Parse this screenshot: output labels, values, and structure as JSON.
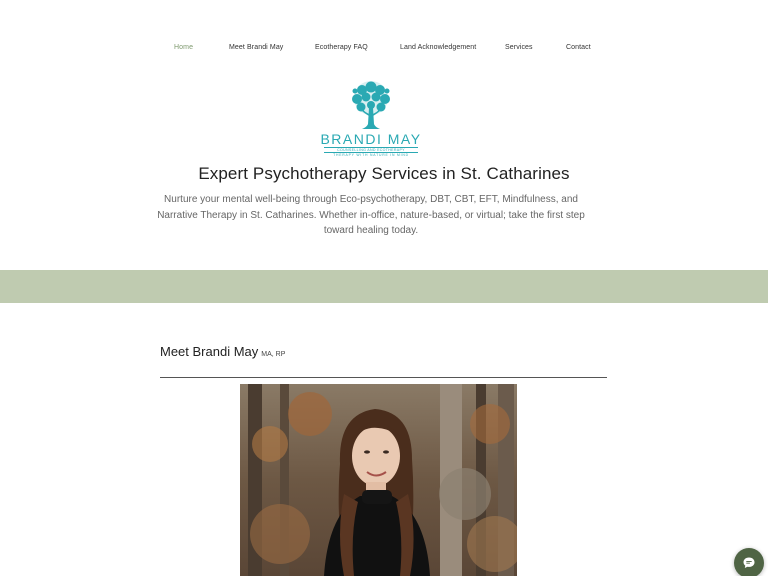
{
  "nav": {
    "items": [
      {
        "label": "Home",
        "active": true
      },
      {
        "label": "Meet Brandi May",
        "active": false
      },
      {
        "label": "Ecotherapy FAQ",
        "active": false
      },
      {
        "label": "Land Acknowledgement",
        "active": false
      },
      {
        "label": "Services",
        "active": false
      },
      {
        "label": "Contact",
        "active": false
      }
    ]
  },
  "logo": {
    "name": "BRANDI MAY",
    "subtitle": "COUNSELLING AND ECOTHERAPY",
    "tagline": "THERAPY WITH NATURE IN MIND",
    "color": "#2aa9b3"
  },
  "hero": {
    "title": "Expert Psychotherapy Services in St. Catharines",
    "subtitle": "Nurture your mental well-being through Eco-psychotherapy, DBT, CBT, EFT, Mindfulness, and Narrative Therapy in St. Catharines. Whether in-office, nature-based, or virtual; take the first step toward healing today."
  },
  "meet": {
    "title": "Meet Brandi May",
    "credentials": "MA, RP"
  },
  "colors": {
    "accent_band": "#bfcbb0",
    "nav_active": "#7f9a6f",
    "chat_button": "#4f6444"
  },
  "chat": {
    "icon": "chat-bubble-icon"
  }
}
